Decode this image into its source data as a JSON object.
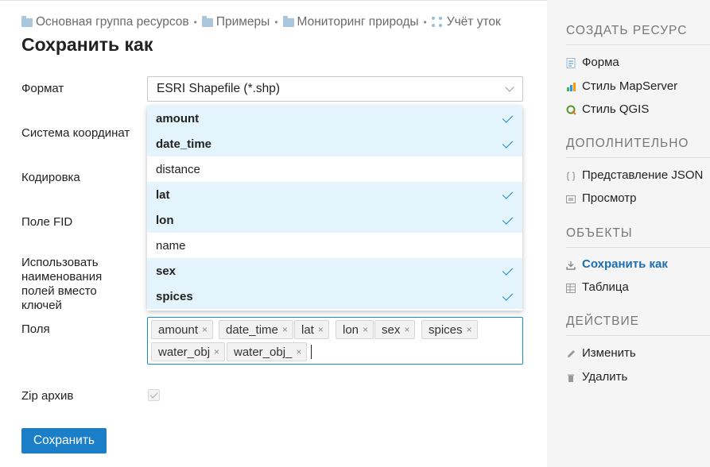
{
  "breadcrumb": {
    "items": [
      "Основная группа ресурсов",
      "Примеры",
      "Мониторинг природы",
      "Учёт уток"
    ],
    "separator": "•"
  },
  "page_title": "Сохранить как",
  "form": {
    "format_label": "Формат",
    "format_value": "ESRI Shapefile (*.shp)",
    "crs_label": "Система координат",
    "encoding_label": "Кодировка",
    "fid_label": "Поле FID",
    "use_names_label": "Использовать наименования полей вместо ключей",
    "fields_label": "Поля",
    "zip_label": "Zip архив",
    "zip_checked": true,
    "save_button": "Сохранить"
  },
  "dropdown_options": [
    {
      "label": "amount",
      "selected": true
    },
    {
      "label": "date_time",
      "selected": true
    },
    {
      "label": "distance",
      "selected": false
    },
    {
      "label": "lat",
      "selected": true
    },
    {
      "label": "lon",
      "selected": true
    },
    {
      "label": "name",
      "selected": false
    },
    {
      "label": "sex",
      "selected": true
    },
    {
      "label": "spices",
      "selected": true
    }
  ],
  "selected_tags": [
    "amount",
    "date_time",
    "lat",
    "lon",
    "sex",
    "spices",
    "water_obj",
    "water_obj_"
  ],
  "tag_remove_symbol": "×",
  "sidebar": {
    "sections": [
      {
        "title": "СОЗДАТЬ РЕСУРС",
        "items": [
          {
            "label": "Форма",
            "icon": "form-icon"
          },
          {
            "label": "Стиль MapServer",
            "icon": "mapserver-style-icon"
          },
          {
            "label": "Стиль QGIS",
            "icon": "qgis-style-icon"
          }
        ]
      },
      {
        "title": "ДОПОЛНИТЕЛЬНО",
        "items": [
          {
            "label": "Представление JSON",
            "icon": "json-icon"
          },
          {
            "label": "Просмотр",
            "icon": "preview-icon"
          }
        ]
      },
      {
        "title": "ОБЪЕКТЫ",
        "items": [
          {
            "label": "Сохранить как",
            "icon": "download-icon",
            "active": true
          },
          {
            "label": "Таблица",
            "icon": "table-icon"
          }
        ]
      },
      {
        "title": "ДЕЙСТВИЕ",
        "items": [
          {
            "label": "Изменить",
            "icon": "pencil-icon"
          },
          {
            "label": "Удалить",
            "icon": "trash-icon"
          }
        ]
      }
    ]
  },
  "colors": {
    "accent": "#1a7ec9",
    "selected_row": "#e4f4fc",
    "check": "#1a8bd1",
    "sidebar_bg": "#f5f5f5"
  }
}
